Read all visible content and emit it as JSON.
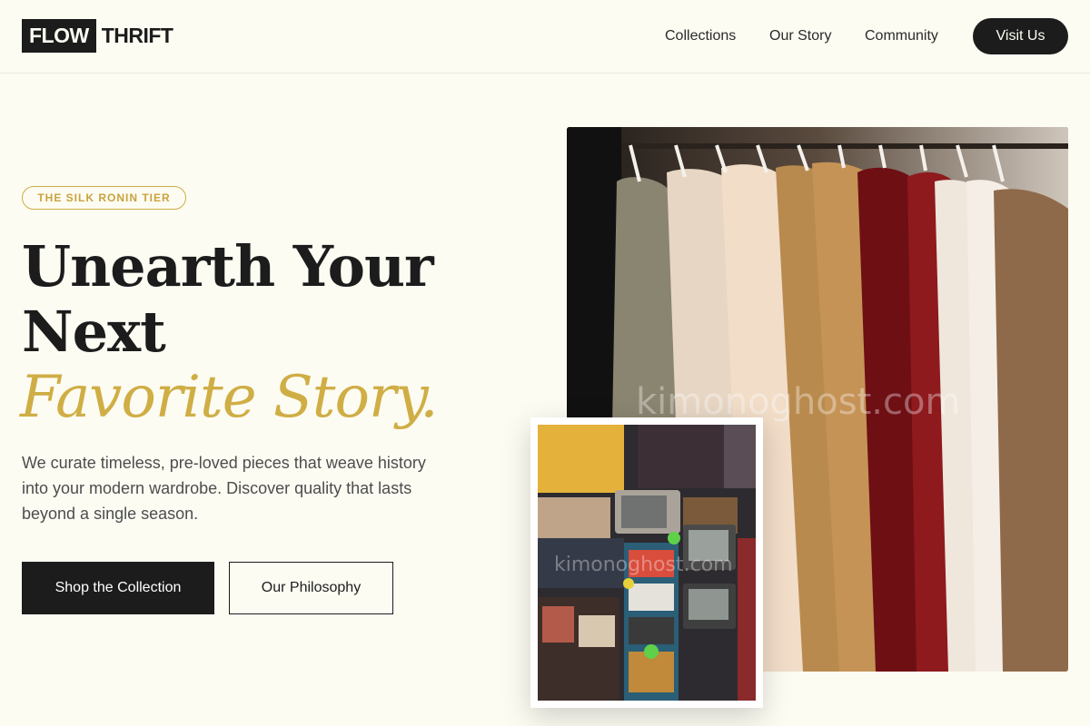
{
  "header": {
    "logo_box": "FLOW",
    "logo_rest": "THRIFT",
    "nav": [
      "Collections",
      "Our Story",
      "Community"
    ],
    "cta": "Visit Us"
  },
  "hero": {
    "badge": "THE SILK RONIN TIER",
    "headline_line1": "Unearth Your",
    "headline_line2": "Next",
    "headline_accent": "Favorite Story.",
    "lede": "We curate timeless, pre-loved pieces that weave history into your modern wardrobe. Discover quality that lasts beyond a single season.",
    "primary_button": "Shop the Collection",
    "secondary_button": "Our Philosophy"
  },
  "images": {
    "watermark_main": "kimonoghost.com",
    "watermark_secondary": "kimonoghost.com"
  },
  "colors": {
    "background": "#fdfcf3",
    "ink": "#1c1c1c",
    "accent_gold": "#cfae45",
    "body_text": "#4d4d4d"
  }
}
